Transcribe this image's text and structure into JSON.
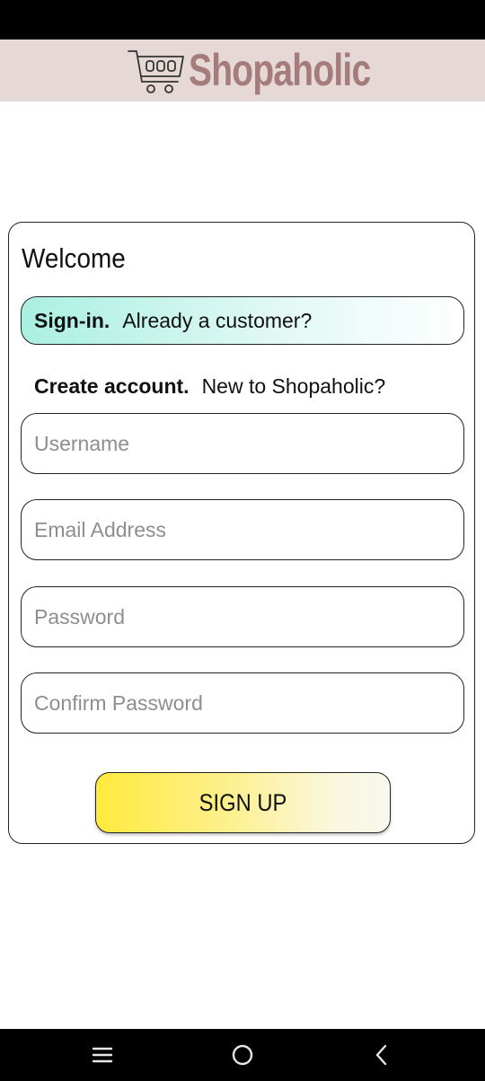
{
  "header": {
    "app_name": "Shopaholic",
    "logo_icon": "shopping-cart-icon",
    "background_color": "#e5d8d6",
    "logo_color": "#a47c7c"
  },
  "welcome": {
    "title": "Welcome",
    "signin": {
      "bold_label": "Sign-in.",
      "text": "Already a customer?",
      "selected": true
    },
    "create": {
      "bold_label": "Create account.",
      "text": "New to Shopaholic?"
    },
    "fields": {
      "username": {
        "placeholder": "Username",
        "value": ""
      },
      "email": {
        "placeholder": "Email Address",
        "value": ""
      },
      "password": {
        "placeholder": "Password",
        "value": ""
      },
      "confirm_password": {
        "placeholder": "Confirm Password",
        "value": ""
      }
    },
    "signup_button_label": "SIGN UP",
    "accent_colors": {
      "signin_highlight": "#aaf0e2",
      "signup_button": "#ffea3d"
    }
  },
  "navigation": {
    "recents_icon": "recent-apps-icon",
    "home_icon": "home-icon",
    "back_icon": "back-icon"
  }
}
